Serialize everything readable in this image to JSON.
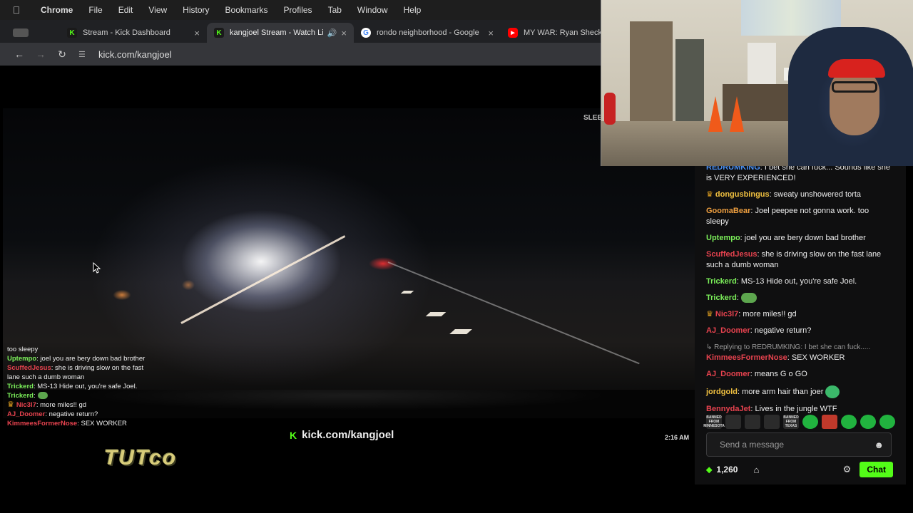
{
  "menubar": {
    "items": [
      "Chrome",
      "File",
      "Edit",
      "View",
      "History",
      "Bookmarks",
      "Profiles",
      "Tab",
      "Window",
      "Help"
    ]
  },
  "tabs": [
    {
      "title": "Stream - Kick Dashboard",
      "favicon": "kick-icon"
    },
    {
      "title": "kangjoel Stream - Watch Li",
      "favicon": "kick-icon",
      "active": true
    },
    {
      "title": "rondo neighborhood - Google",
      "favicon": "google-icon"
    },
    {
      "title": "MY WAR: Ryan Shecklo",
      "favicon": "youtube-icon"
    }
  ],
  "toolbar": {
    "url": "kick.com/kangjoel"
  },
  "video": {
    "sleep_label": "SLEE",
    "watermark": "kick.com/kangjoel",
    "clock": "2:16 AM",
    "brand": "TUTco",
    "overlay_chat": [
      {
        "user": "",
        "text": "too sleepy",
        "color": "#eeeeee"
      },
      {
        "user": "Uptempo",
        "text": ": joel you are bery down bad brother",
        "color": "#7cf05a"
      },
      {
        "user": "ScuffedJesus",
        "text": ": she is driving slow on the fast lane such a dumb woman",
        "color": "#e8434f"
      },
      {
        "user": "Trickerd",
        "text": ": MS-13 Hide out, you're safe Joel.",
        "color": "#7cf05a"
      },
      {
        "user": "Trickerd",
        "text": ":",
        "color": "#7cf05a",
        "emote": true
      },
      {
        "user": "Nic3l7",
        "text": ": more miles!! gd",
        "color": "#e8434f",
        "crown": true
      },
      {
        "user": "AJ_Doomer",
        "text": ": negative return?",
        "color": "#e8434f"
      },
      {
        "user": "KimmeesFormerNose",
        "text": ": SEX WORKER",
        "color": "#e8434f"
      }
    ]
  },
  "chat": {
    "messages": [
      {
        "user": "REDRUMKING",
        "text": ": I bet she can fuck... Sounds like she is VERY EXPERIENCED!",
        "color": "#4a8ff0"
      },
      {
        "user": "dongusbingus",
        "text": ": sweaty unshowered torta",
        "color": "#f0c040",
        "crown": true
      },
      {
        "user": "GoomaBear",
        "text": ": Joel peepee not gonna work. too sleepy",
        "color": "#f0a040"
      },
      {
        "user": "Uptempo",
        "text": ": joel you are bery down bad brother",
        "color": "#7cf05a"
      },
      {
        "user": "ScuffedJesus",
        "text": ": she is driving slow on the fast lane such a dumb woman",
        "color": "#e8434f"
      },
      {
        "user": "Trickerd",
        "text": ": MS-13 Hide out, you're safe Joel.",
        "color": "#7cf05a"
      },
      {
        "user": "Trickerd",
        "text": ":",
        "color": "#7cf05a",
        "emote": true
      },
      {
        "user": "Nic3l7",
        "text": ": more miles!! gd",
        "color": "#e8434f",
        "crown": true
      },
      {
        "user": "AJ_Doomer",
        "text": ": negative return?",
        "color": "#e8434f"
      },
      {
        "reply": "Replying to REDRUMKING: I bet she can fuck....."
      },
      {
        "user": "KimmeesFormerNose",
        "text": ": SEX WORKER",
        "color": "#e8434f"
      },
      {
        "user": "AJ_Doomer",
        "text": ": means G o GO",
        "color": "#e8434f"
      },
      {
        "user": "jordgold",
        "text": ": more arm hair than joer",
        "color": "#f0c040",
        "emote2": true
      },
      {
        "user": "BennydaJet",
        "text": ": Lives in the jungle WTF",
        "color": "#e8434f"
      }
    ],
    "emote_labels": [
      "BANNED FROM MINNESOTA",
      "BANNED FROM TEXAS"
    ],
    "send_placeholder": "Send a message",
    "points": "1,260",
    "chat_button": "Chat"
  },
  "colors": {
    "kick_green": "#53fc18",
    "panel_bg": "#0f0f10"
  }
}
